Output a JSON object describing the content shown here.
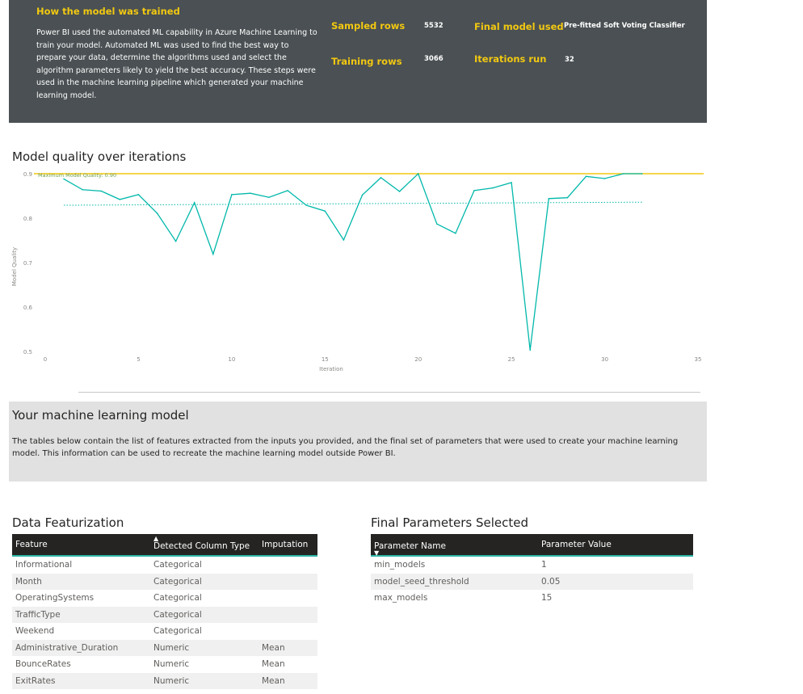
{
  "banner": {
    "title": "How the model was trained",
    "description": "Power BI used the automated ML capability in Azure Machine Learning to train your model. Automated ML was used to find the best way to prepare your data, determine the algorithms used and select the algorithm parameters likely to yield the best accuracy. These steps were used in the machine learning pipeline which generated your machine learning model.",
    "stats": {
      "sampled_rows_label": "Sampled rows",
      "sampled_rows_value": "5532",
      "training_rows_label": "Training rows",
      "training_rows_value": "3066",
      "final_model_label": "Final model used",
      "final_model_value": "Pre-fitted Soft Voting Classifier",
      "iterations_label": "Iterations run",
      "iterations_value": "32"
    },
    "colors": {
      "background": "#4a5053",
      "accent": "#f2c811"
    }
  },
  "chart_title": "Model quality over iterations",
  "chart_data": {
    "type": "line",
    "xlabel": "Iteration",
    "ylabel": "Model Quality",
    "xlim": [
      0,
      35
    ],
    "ylim": [
      0.5,
      0.9
    ],
    "x_ticks": [
      0,
      5,
      10,
      15,
      20,
      25,
      30,
      35
    ],
    "y_ticks": [
      0.5,
      0.6,
      0.7,
      0.8,
      0.9
    ],
    "y_tick_labels": [
      "0.5",
      "0.6",
      "0.7",
      "0.8",
      "0.9"
    ],
    "grid": false,
    "reference_line": {
      "label": "Maximum Model Quality: 0.90",
      "value": 0.9,
      "color": "#f2c811"
    },
    "series": [
      {
        "x": [
          1,
          2,
          3,
          4,
          5,
          6,
          7,
          8,
          9,
          10,
          11,
          12,
          13,
          14,
          15,
          16,
          17,
          18,
          19,
          20,
          21,
          22,
          23,
          24,
          25,
          26,
          27,
          28,
          29,
          30,
          31,
          32
        ],
        "values": [
          0.888,
          0.864,
          0.861,
          0.842,
          0.853,
          0.811,
          0.748,
          0.835,
          0.719,
          0.853,
          0.856,
          0.847,
          0.862,
          0.829,
          0.816,
          0.751,
          0.852,
          0.891,
          0.86,
          0.9,
          0.787,
          0.766,
          0.862,
          0.868,
          0.88,
          0.503,
          0.844,
          0.846,
          0.894,
          0.889,
          0.9,
          0.9
        ],
        "color": "#01b8aa"
      }
    ],
    "trend_line": {
      "x": [
        1,
        32
      ],
      "values": [
        0.829,
        0.836
      ],
      "color": "#01b8aa",
      "style": "dotted"
    }
  },
  "model_section": {
    "title": "Your machine learning model",
    "description": "The tables below contain the list of features extracted from the inputs you provided, and the final set of parameters that were used to create your machine learning model.  This information can be used to recreate the machine learning model outside Power BI."
  },
  "featurization": {
    "title": "Data Featurization",
    "headers": [
      "Feature",
      "Detected Column Type",
      "Imputation"
    ],
    "rows": [
      [
        "Informational",
        "Categorical",
        ""
      ],
      [
        "Month",
        "Categorical",
        ""
      ],
      [
        "OperatingSystems",
        "Categorical",
        ""
      ],
      [
        "TrafficType",
        "Categorical",
        ""
      ],
      [
        "Weekend",
        "Categorical",
        ""
      ],
      [
        "Administrative_Duration",
        "Numeric",
        "Mean"
      ],
      [
        "BounceRates",
        "Numeric",
        "Mean"
      ],
      [
        "ExitRates",
        "Numeric",
        "Mean"
      ]
    ]
  },
  "parameters": {
    "title": "Final Parameters Selected",
    "headers": [
      "Parameter Name",
      "Parameter Value"
    ],
    "rows": [
      [
        "min_models",
        "1"
      ],
      [
        "model_seed_threshold",
        "0.05"
      ],
      [
        "max_models",
        "15"
      ]
    ]
  }
}
